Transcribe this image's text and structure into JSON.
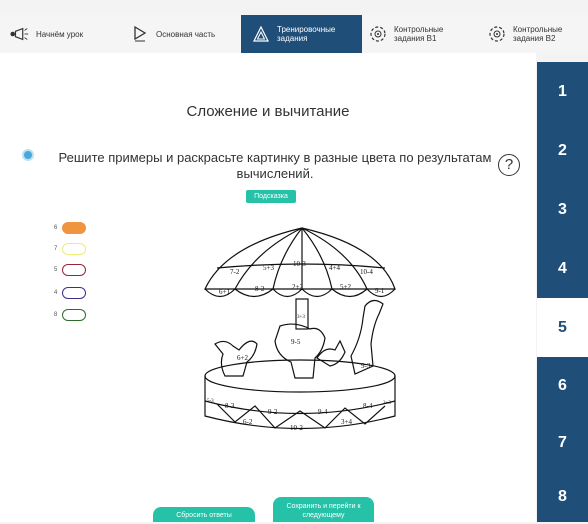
{
  "nav": [
    {
      "label": "Начнём урок",
      "icon": "megaphone-icon"
    },
    {
      "label": "Основная часть",
      "icon": "play-icon"
    },
    {
      "label": "Тренировочные задания",
      "icon": "triangle-icon",
      "active": true
    },
    {
      "label": "Контрольные задания В1",
      "icon": "target-icon"
    },
    {
      "label": "Контрольные задания В2",
      "icon": "target-icon"
    }
  ],
  "title": "Сложение и вычитание",
  "task": "Решите примеры и раскрасьте картинку в разные цвета по результатам вычислений.",
  "help_icon": "?",
  "hint_label": "Подсказка",
  "palette": [
    {
      "value": "6",
      "color": "#f0953f",
      "filled": true
    },
    {
      "value": "7",
      "color": "#eded7a",
      "filled": false
    },
    {
      "value": "5",
      "color": "#9b2335",
      "filled": false
    },
    {
      "value": "4",
      "color": "#3b2f8f",
      "filled": false
    },
    {
      "value": "8",
      "color": "#2d6b2d",
      "filled": false
    }
  ],
  "picture": {
    "canopy": [
      "7-2",
      "5+3",
      "10-3",
      "4+4",
      "10-4",
      "6+1",
      "8-2",
      "2+2",
      "5+2",
      "9-1"
    ],
    "pole": "3+3",
    "animals": [
      "6+2",
      "9-5",
      "9-3"
    ],
    "base": [
      "8-3",
      "9-2",
      "9-4",
      "8-4",
      "6-2",
      "10-2",
      "3+4",
      "5-3",
      "2+3"
    ]
  },
  "buttons": {
    "reset": "Сбросить ответы",
    "save": "Сохранить и перейти к следующему"
  },
  "side_tabs": [
    "1",
    "2",
    "3",
    "4",
    "5",
    "6",
    "7",
    "8"
  ],
  "active_tab": "5",
  "colors": {
    "accent": "#25c2a8",
    "navy": "#1f4e79"
  }
}
